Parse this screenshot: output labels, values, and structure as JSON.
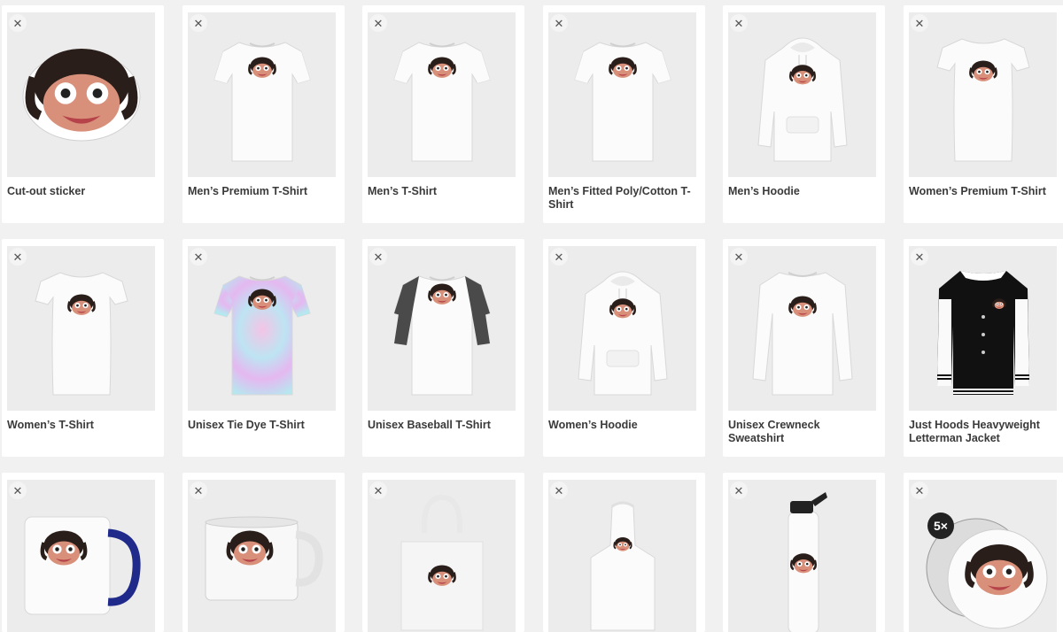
{
  "remove_glyph": "✕",
  "products": [
    {
      "label": "Cut-out sticker",
      "kind": "sticker"
    },
    {
      "label": "Men’s Premium T-Shirt",
      "kind": "tee"
    },
    {
      "label": "Men’s T-Shirt",
      "kind": "tee"
    },
    {
      "label": "Men’s Fitted Poly/Cotton T-Shirt",
      "kind": "tee"
    },
    {
      "label": "Men’s Hoodie",
      "kind": "hoodie"
    },
    {
      "label": "Women’s Premium T-Shirt",
      "kind": "tee-women"
    },
    {
      "label": "Women’s T-Shirt",
      "kind": "tee-women"
    },
    {
      "label": "Unisex Tie Dye T-Shirt",
      "kind": "tiedye"
    },
    {
      "label": "Unisex Baseball T-Shirt",
      "kind": "baseball"
    },
    {
      "label": "Women’s Hoodie",
      "kind": "hoodie"
    },
    {
      "label": "Unisex Crewneck Sweatshirt",
      "kind": "sweatshirt"
    },
    {
      "label": "Just Hoods Heavyweight Letterman Jacket",
      "kind": "jacket"
    },
    {
      "label": "",
      "kind": "mug"
    },
    {
      "label": "",
      "kind": "camper-mug"
    },
    {
      "label": "",
      "kind": "tote"
    },
    {
      "label": "",
      "kind": "apron"
    },
    {
      "label": "",
      "kind": "bottle"
    },
    {
      "label": "",
      "kind": "buttons",
      "badge": "5×"
    }
  ],
  "colors": {
    "background": "#f1f1f1",
    "card": "#ffffff",
    "thumb": "#ececec",
    "label": "#3a3a3a",
    "jacket_body": "#111111",
    "baseball_sleeve": "#4a4a4a",
    "mug_handle": "#1f2a8a"
  }
}
